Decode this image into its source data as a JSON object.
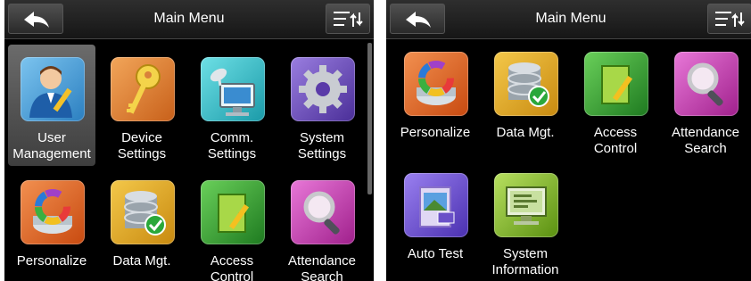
{
  "screens": [
    {
      "title": "Main Menu",
      "items": [
        {
          "line1": "User",
          "line2": "Management",
          "icon": "user-management-icon"
        },
        {
          "line1": "Device",
          "line2": "Settings",
          "icon": "key-icon"
        },
        {
          "line1": "Comm.",
          "line2": "Settings",
          "icon": "comm-icon"
        },
        {
          "line1": "System",
          "line2": "Settings",
          "icon": "gear-icon"
        },
        {
          "line1": "Personalize",
          "line2": "",
          "icon": "color-wheel-icon"
        },
        {
          "line1": "Data Mgt.",
          "line2": "",
          "icon": "database-icon"
        },
        {
          "line1": "Access",
          "line2": "Control",
          "icon": "door-icon"
        },
        {
          "line1": "Attendance",
          "line2": "Search",
          "icon": "magnifier-icon"
        }
      ]
    },
    {
      "title": "Main Menu",
      "items": [
        {
          "line1": "Personalize",
          "line2": "",
          "icon": "color-wheel-icon"
        },
        {
          "line1": "Data Mgt.",
          "line2": "",
          "icon": "database-icon"
        },
        {
          "line1": "Access",
          "line2": "Control",
          "icon": "door-icon"
        },
        {
          "line1": "Attendance",
          "line2": "Search",
          "icon": "magnifier-icon"
        },
        {
          "line1": "Auto Test",
          "line2": "",
          "icon": "auto-test-icon"
        },
        {
          "line1": "System",
          "line2": "Information",
          "icon": "system-info-icon"
        }
      ]
    }
  ],
  "colors": {
    "user": "#3a9ad6",
    "device": "#e07a1e",
    "comm": "#2bb3c0",
    "system": "#6a48b8",
    "personalize": "#e06020",
    "data": "#e0a020",
    "access": "#2e9a30",
    "attendance": "#c02fa8",
    "autotest": "#6a4cc8",
    "sysinfo": "#7bb020"
  }
}
